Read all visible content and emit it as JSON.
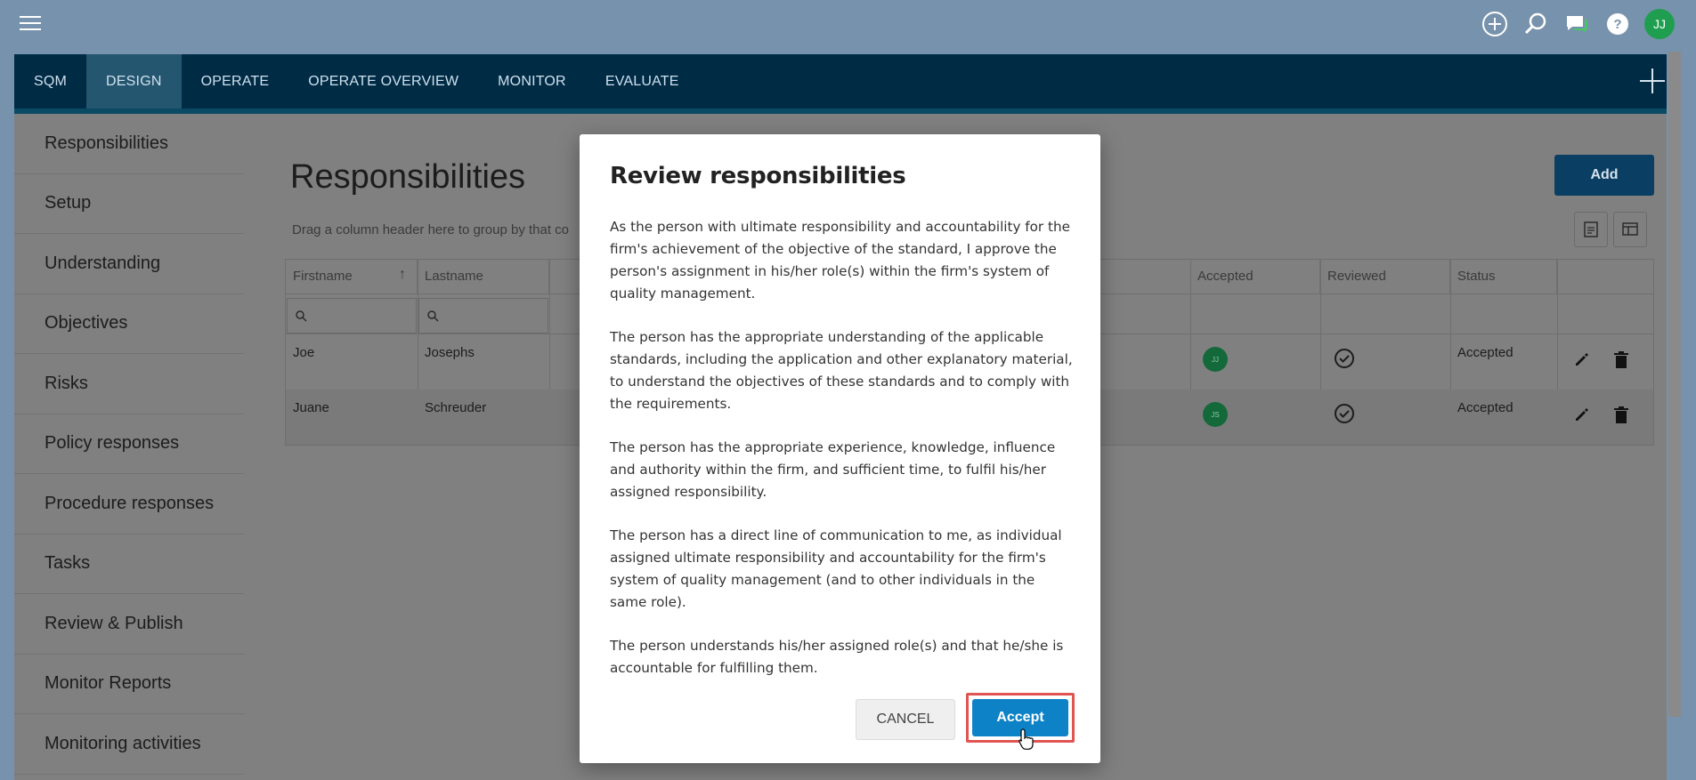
{
  "nav": {
    "tabs": [
      {
        "label": "SQM",
        "active": false
      },
      {
        "label": "DESIGN",
        "active": true
      },
      {
        "label": "OPERATE",
        "active": false
      },
      {
        "label": "OPERATE OVERVIEW",
        "active": false
      },
      {
        "label": "MONITOR",
        "active": false
      },
      {
        "label": "EVALUATE",
        "active": false
      }
    ]
  },
  "topbar": {
    "user_initials": "JJ",
    "icons": [
      "plus-circle-icon",
      "search-icon",
      "chat-icon",
      "help-icon"
    ]
  },
  "sidebar": {
    "items": [
      "Responsibilities",
      "Setup",
      "Understanding",
      "Objectives",
      "Risks",
      "Policy responses",
      "Procedure responses",
      "Tasks",
      "Review & Publish",
      "Monitor Reports",
      "Monitoring activities"
    ]
  },
  "main": {
    "title": "Responsibilities",
    "group_hint": "Drag a column header here to group by that co",
    "add_label": "Add",
    "columns": [
      "Firstname",
      "Lastname",
      "Accepted",
      "Reviewed",
      "Status"
    ],
    "rows": [
      {
        "firstname": "Joe",
        "lastname": "Josephs",
        "initials": "JJ",
        "status": "Accepted"
      },
      {
        "firstname": "Juane",
        "lastname": "Schreuder",
        "initials": "JS",
        "status": "Accepted"
      }
    ]
  },
  "modal": {
    "title": "Review responsibilities",
    "paragraphs": [
      "As the person with ultimate responsibility and accountability for the firm's achievement of the objective of the standard, I approve the person's assignment in his/her role(s) within the firm's system of quality management.",
      "The person has the appropriate understanding of the applicable standards, including the application and other explanatory material, to understand the objectives of these standards and to comply with the requirements.",
      "The person has the appropriate experience, knowledge, influence and authority within the firm, and sufficient time, to fulfil his/her assigned responsibility.",
      "The person has a direct line of communication to me, as individual assigned ultimate responsibility and accountability for the firm's system of quality management (and to other individuals in the same role).",
      "The person understands his/her assigned role(s) and that he/she is accountable for fulfilling them."
    ],
    "cancel_label": "CANCEL",
    "accept_label": "Accept"
  },
  "colors": {
    "nav_bg": "#002b45",
    "accent": "#0d82c6",
    "highlight": "#e05552",
    "avatar": "#1f9e4f"
  }
}
